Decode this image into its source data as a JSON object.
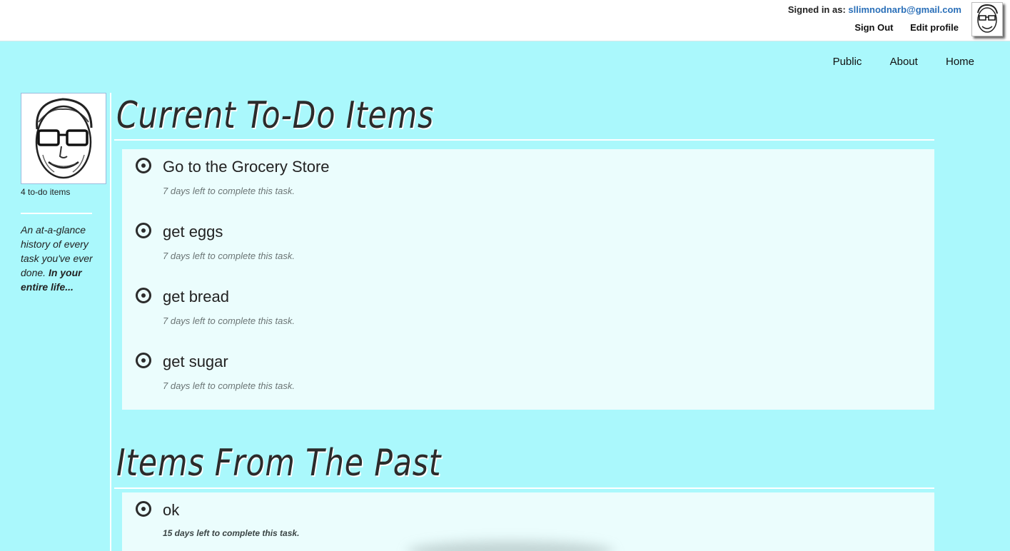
{
  "account": {
    "signed_in_label": "Signed in as:",
    "email": "sllimnodnarb@gmail.com",
    "sign_out": "Sign Out",
    "edit_profile": "Edit profile"
  },
  "nav": {
    "public": "Public",
    "about": "About",
    "home": "Home"
  },
  "sidebar": {
    "todo_count": "4 to-do items",
    "tagline_italic": "An at-a-glance history of every task you've ever done.",
    "tagline_bold": "In your entire life..."
  },
  "current": {
    "title": "Current To-Do Items",
    "items": [
      {
        "name": "Go to the Grocery Store",
        "due": "7 days left to complete this task."
      },
      {
        "name": "get eggs",
        "due": "7 days left to complete this task."
      },
      {
        "name": "get bread",
        "due": "7 days left to complete this task."
      },
      {
        "name": "get sugar",
        "due": "7 days left to complete this task."
      }
    ]
  },
  "past": {
    "title": "Items From The Past",
    "items": [
      {
        "name": "ok",
        "due": "15 days left to complete this task."
      }
    ]
  },
  "colors": {
    "background": "#aaf8fc",
    "panel": "#ebfdfd",
    "link": "#2a6fb8"
  }
}
